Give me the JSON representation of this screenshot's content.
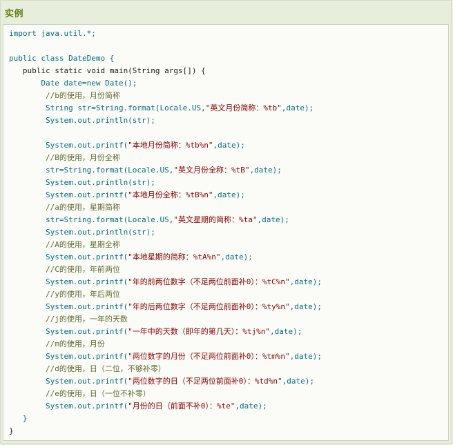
{
  "section_title": "实例",
  "code_lines": [
    [
      {
        "t": "import java.util.*;",
        "c": "cls"
      }
    ],
    [
      {
        "t": "",
        "c": "plain"
      }
    ],
    [
      {
        "t": "public class DateDemo {",
        "c": "cls"
      }
    ],
    [
      {
        "t": "   public static void main(String args[]) {",
        "c": "plain"
      }
    ],
    [
      {
        "t": "       Date date=new Date();",
        "c": "cls"
      }
    ],
    [
      {
        "t": "        //b的使用，月份简称",
        "c": "comment"
      }
    ],
    [
      {
        "t": "        String str=String.format(Locale.US,",
        "c": "cls"
      },
      {
        "t": "\"英文月份简称：%tb\"",
        "c": "str"
      },
      {
        "t": ",date);",
        "c": "cls"
      }
    ],
    [
      {
        "t": "        System.out.println(str);",
        "c": "cls"
      }
    ],
    [
      {
        "t": "",
        "c": "plain"
      }
    ],
    [
      {
        "t": "        System.out.printf(",
        "c": "cls"
      },
      {
        "t": "\"本地月份简称：%tb%n\"",
        "c": "str"
      },
      {
        "t": ",date);",
        "c": "cls"
      }
    ],
    [
      {
        "t": "        //B的使用，月份全称",
        "c": "comment"
      }
    ],
    [
      {
        "t": "        str=String.format(Locale.US,",
        "c": "cls"
      },
      {
        "t": "\"英文月份全称：%tB\"",
        "c": "str"
      },
      {
        "t": ",date);",
        "c": "cls"
      }
    ],
    [
      {
        "t": "        System.out.println(str);",
        "c": "cls"
      }
    ],
    [
      {
        "t": "        System.out.printf(",
        "c": "cls"
      },
      {
        "t": "\"本地月份全称：%tB%n\"",
        "c": "str"
      },
      {
        "t": ",date);",
        "c": "cls"
      }
    ],
    [
      {
        "t": "        //a的使用，星期简称",
        "c": "comment"
      }
    ],
    [
      {
        "t": "        str=String.format(Locale.US,",
        "c": "cls"
      },
      {
        "t": "\"英文星期的简称：%ta\"",
        "c": "str"
      },
      {
        "t": ",date);",
        "c": "cls"
      }
    ],
    [
      {
        "t": "        System.out.println(str);",
        "c": "cls"
      }
    ],
    [
      {
        "t": "        //A的使用，星期全称",
        "c": "comment"
      }
    ],
    [
      {
        "t": "        System.out.printf(",
        "c": "cls"
      },
      {
        "t": "\"本地星期的简称：%tA%n\"",
        "c": "str"
      },
      {
        "t": ",date);",
        "c": "cls"
      }
    ],
    [
      {
        "t": "        //C的使用，年前两位",
        "c": "comment"
      }
    ],
    [
      {
        "t": "        System.out.printf(",
        "c": "cls"
      },
      {
        "t": "\"年的前两位数字（不足两位前面补0）：%tC%n\"",
        "c": "str"
      },
      {
        "t": ",date);",
        "c": "cls"
      }
    ],
    [
      {
        "t": "        //y的使用，年后两位",
        "c": "comment"
      }
    ],
    [
      {
        "t": "        System.out.printf(",
        "c": "cls"
      },
      {
        "t": "\"年的后两位数字（不足两位前面补0）：%ty%n\"",
        "c": "str"
      },
      {
        "t": ",date);",
        "c": "cls"
      }
    ],
    [
      {
        "t": "        //j的使用，一年的天数",
        "c": "comment"
      }
    ],
    [
      {
        "t": "        System.out.printf(",
        "c": "cls"
      },
      {
        "t": "\"一年中的天数（即年的第几天）：%tj%n\"",
        "c": "str"
      },
      {
        "t": ",date);",
        "c": "cls"
      }
    ],
    [
      {
        "t": "        //m的使用，月份",
        "c": "comment"
      }
    ],
    [
      {
        "t": "        System.out.printf(",
        "c": "cls"
      },
      {
        "t": "\"两位数字的月份（不足两位前面补0）：%tm%n\"",
        "c": "str"
      },
      {
        "t": ",date);",
        "c": "cls"
      }
    ],
    [
      {
        "t": "        //d的使用，日（二位，不够补零）",
        "c": "comment"
      }
    ],
    [
      {
        "t": "        System.out.printf(",
        "c": "cls"
      },
      {
        "t": "\"两位数字的日（不足两位前面补0）：%td%n\"",
        "c": "str"
      },
      {
        "t": ",date);",
        "c": "cls"
      }
    ],
    [
      {
        "t": "        //e的使用，日（一位不补零）",
        "c": "comment"
      }
    ],
    [
      {
        "t": "        System.out.printf(",
        "c": "cls"
      },
      {
        "t": "\"月份的日（前面不补0）：%te\"",
        "c": "str"
      },
      {
        "t": ",date);",
        "c": "cls"
      }
    ],
    [
      {
        "t": "   }",
        "c": "cls"
      }
    ],
    [
      {
        "t": "}",
        "c": "plain"
      }
    ]
  ]
}
